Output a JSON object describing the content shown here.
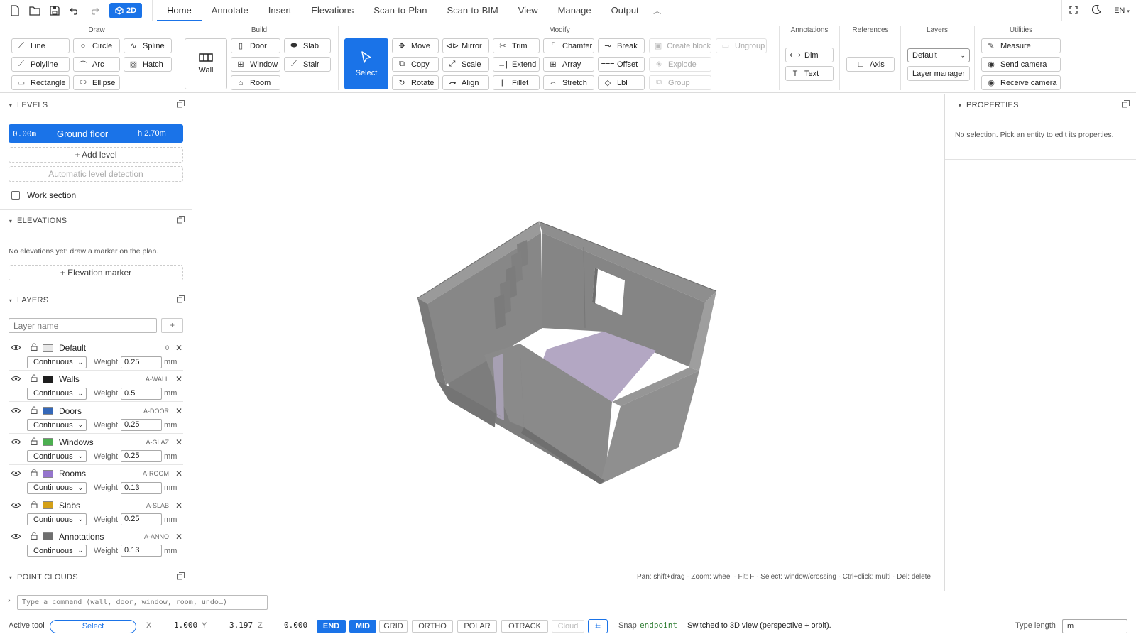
{
  "toolbar": {
    "view_toggle_label": "2D",
    "menu_tabs": [
      "Home",
      "Annotate",
      "Insert",
      "Elevations",
      "Scan-to-Plan",
      "Scan-to-BIM",
      "View",
      "Manage",
      "Output"
    ],
    "language": "EN"
  },
  "ribbon": {
    "draw": {
      "title": "Draw",
      "line": "Line",
      "circle": "Circle",
      "spline": "Spline",
      "polyline": "Polyline",
      "arc": "Arc",
      "hatch": "Hatch",
      "rectangle": "Rectangle",
      "ellipse": "Ellipse"
    },
    "build": {
      "title": "Build",
      "wall": "Wall",
      "door": "Door",
      "slab": "Slab",
      "window": "Window",
      "stair": "Stair",
      "room": "Room"
    },
    "modify": {
      "title": "Modify",
      "select": "Select",
      "move": "Move",
      "mirror": "Mirror",
      "trim": "Trim",
      "chamfer": "Chamfer",
      "break": "Break",
      "create_block": "Create block",
      "ungroup": "Ungroup",
      "copy": "Copy",
      "scale": "Scale",
      "extend": "Extend",
      "array": "Array",
      "offset": "Offset",
      "explode": "Explode",
      "rotate": "Rotate",
      "align": "Align",
      "fillet": "Fillet",
      "stretch": "Stretch",
      "lbl": "Lbl",
      "group": "Group"
    },
    "annotations": {
      "title": "Annotations",
      "dim": "Dim",
      "text": "Text"
    },
    "references": {
      "title": "References",
      "axis": "Axis"
    },
    "layers": {
      "title": "Layers",
      "current": "Default",
      "manager": "Layer manager"
    },
    "utilities": {
      "title": "Utilities",
      "measure": "Measure",
      "send_camera": "Send camera",
      "receive_camera": "Receive camera"
    }
  },
  "levels": {
    "title": "LEVELS",
    "current": {
      "elevation": "0.00m",
      "name": "Ground floor",
      "height": "h 2.70m"
    },
    "add_label": "+ Add level",
    "auto_label": "Automatic level detection",
    "work_section": "Work section"
  },
  "elevations": {
    "title": "ELEVATIONS",
    "empty": "No elevations yet: draw a marker on the plan.",
    "add_label": "+ Elevation marker"
  },
  "layers_panel": {
    "title": "LAYERS",
    "name_placeholder": "Layer name",
    "add": "+",
    "weight_label": "Weight",
    "unit": "mm",
    "items": [
      {
        "name": "Default",
        "code": "0",
        "color": "#e8e8e8",
        "linetype": "Continuous",
        "weight": "0.25"
      },
      {
        "name": "Walls",
        "code": "A-WALL",
        "color": "#1e1e1e",
        "linetype": "Continuous",
        "weight": "0.5"
      },
      {
        "name": "Doors",
        "code": "A-DOOR",
        "color": "#3568b8",
        "linetype": "Continuous",
        "weight": "0.25"
      },
      {
        "name": "Windows",
        "code": "A-GLAZ",
        "color": "#4caf50",
        "linetype": "Continuous",
        "weight": "0.25"
      },
      {
        "name": "Rooms",
        "code": "A-ROOM",
        "color": "#9575cd",
        "linetype": "Continuous",
        "weight": "0.13"
      },
      {
        "name": "Slabs",
        "code": "A-SLAB",
        "color": "#d4a017",
        "linetype": "Continuous",
        "weight": "0.25"
      },
      {
        "name": "Annotations",
        "code": "A-ANNO",
        "color": "#6f6f6f",
        "linetype": "Continuous",
        "weight": "0.13"
      }
    ]
  },
  "point_clouds": {
    "title": "POINT CLOUDS"
  },
  "viewport": {
    "hint": "Pan: shift+drag · Zoom: wheel · Fit: F · Select: window/crossing · Ctrl+click: multi · Del: delete"
  },
  "properties": {
    "title": "PROPERTIES",
    "empty": "No selection. Pick an entity to edit its properties."
  },
  "command": {
    "prompt": "›",
    "placeholder": "Type a command (wall, door, window, room, undo…)"
  },
  "status": {
    "active_tool_label": "Active tool",
    "active_tool": "Select",
    "x_label": "X",
    "x": "1.000",
    "y_label": "Y",
    "y": "3.197",
    "z_label": "Z",
    "z": "0.000",
    "toggles": [
      {
        "label": "END",
        "state": "on"
      },
      {
        "label": "MID",
        "state": "on"
      },
      {
        "label": "GRID",
        "state": "off"
      },
      {
        "label": "ORTHO",
        "state": "off"
      },
      {
        "label": "POLAR",
        "state": "off"
      },
      {
        "label": "OTRACK",
        "state": "off"
      },
      {
        "label": "Cloud",
        "state": "disabled"
      }
    ],
    "snap_label": "Snap",
    "snap_value": "endpoint",
    "message": "Switched to 3D view (perspective + orbit).",
    "type_length_label": "Type length",
    "type_length_value": "m"
  },
  "colors": {
    "accent": "#1a73e8",
    "room_floor": "#b9a9c8",
    "wall": "#8b8b8b"
  }
}
